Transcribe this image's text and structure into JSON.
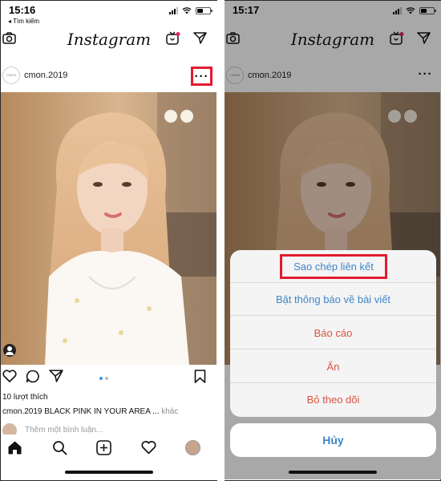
{
  "colors": {
    "highlight": "#e21b2e",
    "blue_action": "#3e86c8",
    "red_action": "#d9533f",
    "link_blue": "#3897f0"
  },
  "left": {
    "status": {
      "time": "15:16",
      "back_label": "◂ Tìm kiếm"
    },
    "nav": {
      "logo": "Instagram",
      "icons": [
        "camera-icon",
        "igtv-icon",
        "direct-message-icon"
      ]
    },
    "post": {
      "username": "cmon.2019",
      "avatar_text": "CMON",
      "more_label": "···",
      "likes": "10 lượt thích",
      "caption_user": "cmon.2019",
      "caption_text": " BLACK PINK IN YOUR AREA ...",
      "caption_more": " khác",
      "comment_placeholder": "Thêm một bình luận..."
    },
    "tabs": [
      "home-icon",
      "search-icon",
      "new-post-icon",
      "activity-icon",
      "profile-icon"
    ]
  },
  "right": {
    "status": {
      "time": "15:17"
    },
    "nav": {
      "logo": "Instagram"
    },
    "post": {
      "username": "cmon.2019",
      "avatar_text": "CMON",
      "more_label": "···"
    },
    "sheet": {
      "items": [
        {
          "label": "Sao chép liên kết",
          "color": "#3e86c8"
        },
        {
          "label": "Bật thông báo về bài viết",
          "color": "#3e86c8"
        },
        {
          "label": "Báo cáo",
          "color": "#d9533f"
        },
        {
          "label": "Ẩn",
          "color": "#d9533f"
        },
        {
          "label": "Bỏ theo dõi",
          "color": "#d9533f"
        }
      ],
      "cancel": "Hủy"
    }
  }
}
